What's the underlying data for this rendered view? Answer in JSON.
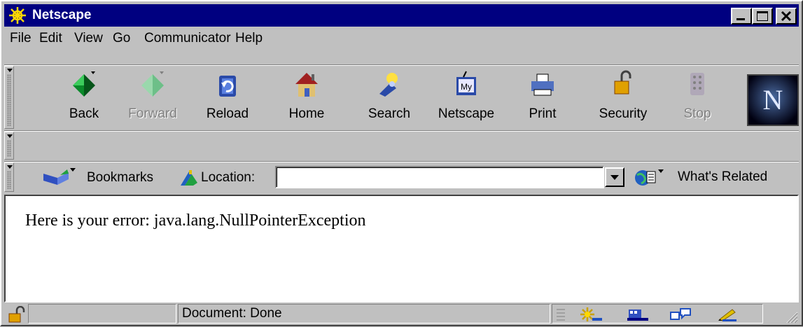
{
  "window": {
    "title": "Netscape"
  },
  "menu": {
    "items": [
      {
        "label": "File"
      },
      {
        "label": "Edit"
      },
      {
        "label": "View"
      },
      {
        "label": "Go"
      },
      {
        "label": "Communicator"
      },
      {
        "label": "Help"
      }
    ]
  },
  "toolbar": {
    "buttons": [
      {
        "label": "Back",
        "enabled": true,
        "icon": "back-icon"
      },
      {
        "label": "Forward",
        "enabled": false,
        "icon": "forward-icon"
      },
      {
        "label": "Reload",
        "enabled": true,
        "icon": "reload-icon"
      },
      {
        "label": "Home",
        "enabled": true,
        "icon": "home-icon"
      },
      {
        "label": "Search",
        "enabled": true,
        "icon": "search-icon"
      },
      {
        "label": "Netscape",
        "enabled": true,
        "icon": "netscape-portal-icon"
      },
      {
        "label": "Print",
        "enabled": true,
        "icon": "print-icon"
      },
      {
        "label": "Security",
        "enabled": true,
        "icon": "security-lock-icon"
      },
      {
        "label": "Stop",
        "enabled": false,
        "icon": "stop-icon"
      }
    ],
    "logo_letter": "N"
  },
  "location_bar": {
    "bookmarks_label": "Bookmarks",
    "location_label": "Location:",
    "url_value": "",
    "whats_related_label": "What's Related"
  },
  "content": {
    "text": "Here is your error: java.lang.NullPointerException"
  },
  "status_bar": {
    "text": "Document: Done"
  },
  "colors": {
    "titlebar": "#000080",
    "face": "#c0c0c0",
    "content_bg": "#ffffff"
  }
}
